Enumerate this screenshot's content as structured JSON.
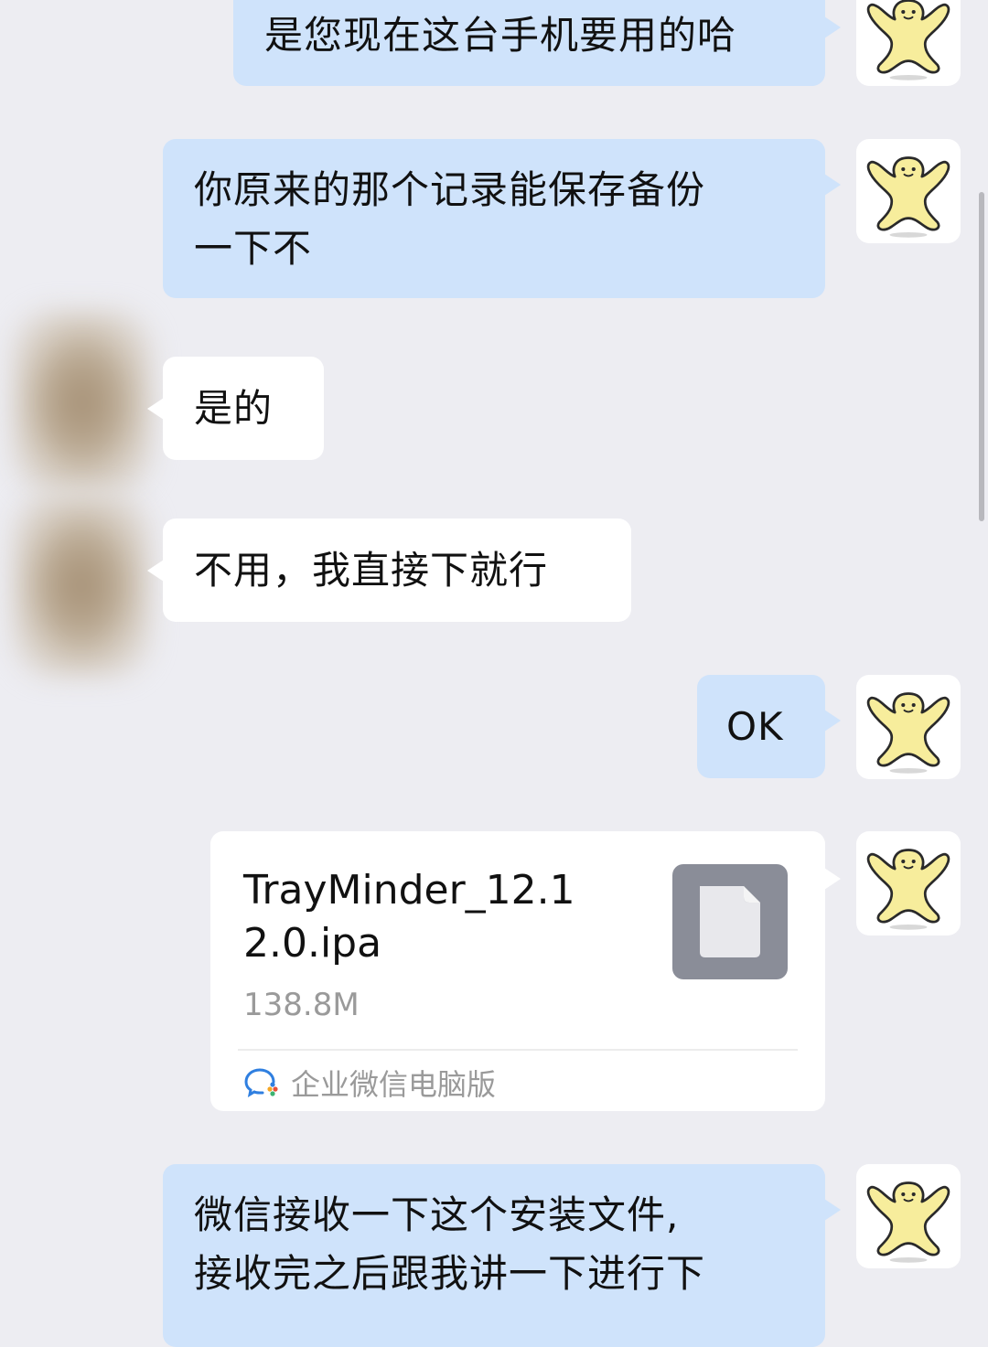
{
  "messages": [
    {
      "side": "outgoing",
      "text": "是您现在这台手机要用的哈"
    },
    {
      "side": "outgoing",
      "lines": [
        "你原来的那个记录能保存备份",
        "一下不"
      ]
    },
    {
      "side": "incoming",
      "text": "是的"
    },
    {
      "side": "incoming",
      "text": "不用，我直接下就行"
    },
    {
      "side": "outgoing",
      "text": "OK"
    },
    {
      "side": "outgoing",
      "type": "file",
      "file": {
        "name": "TrayMinder_12.12.0.ipa",
        "size": "138.8M",
        "source": "企业微信电脑版",
        "icon": "document-icon"
      }
    },
    {
      "side": "outgoing",
      "lines": [
        "微信接收一下这个安装文件,",
        "接收完之后跟我讲一下进行下"
      ]
    }
  ],
  "avatars": {
    "outgoing": "yellow-mascot-icon",
    "incoming": "blurred-avatar"
  },
  "colors": {
    "background": "#ededf2",
    "outgoing_bubble": "#cfe3fb",
    "incoming_bubble": "#ffffff",
    "file_icon": "#8a8d98",
    "muted_text": "#9a9a9a"
  }
}
